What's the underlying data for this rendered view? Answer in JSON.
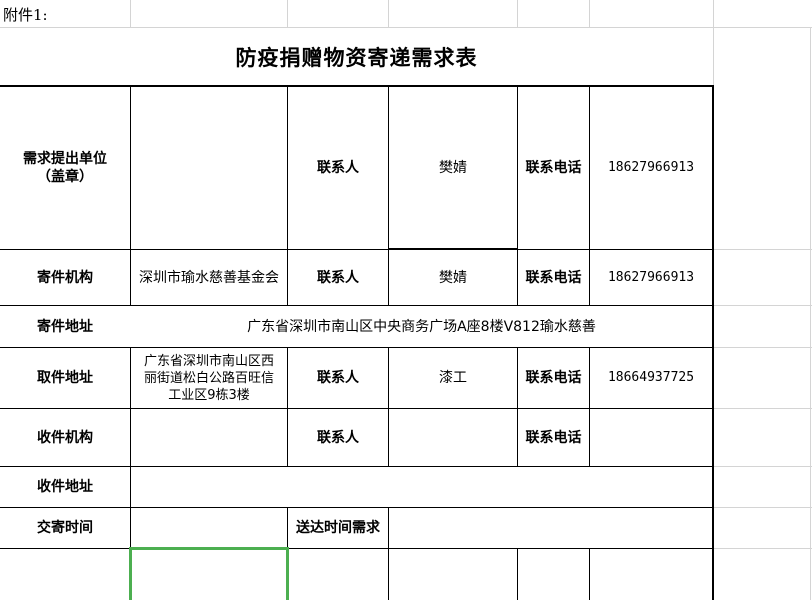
{
  "sheet": {
    "attachment_label": "附件1:",
    "title": "防疫捐赠物资寄递需求表"
  },
  "form": {
    "row1": {
      "label": "需求提出单位\n（盖章）",
      "value": "",
      "contact_label": "联系人",
      "contact_value": "樊婧",
      "phone_label": "联系电话",
      "phone_value": "18627966913"
    },
    "row2": {
      "label": "寄件机构",
      "value": "深圳市瑜水慈善基金会",
      "contact_label": "联系人",
      "contact_value": "樊婧",
      "phone_label": "联系电话",
      "phone_value": "18627966913"
    },
    "row3": {
      "label": "寄件地址",
      "value": "广东省深圳市南山区中央商务广场A座8楼V812瑜水慈善"
    },
    "row4": {
      "label": "取件地址",
      "value": "广东省深圳市南山区西\n丽街道松白公路百旺信\n工业区9栋3楼",
      "contact_label": "联系人",
      "contact_value": "漆工",
      "phone_label": "联系电话",
      "phone_value": "18664937725"
    },
    "row5": {
      "label": "收件机构",
      "value": "",
      "contact_label": "联系人",
      "contact_value": "",
      "phone_label": "联系电话",
      "phone_value": ""
    },
    "row6": {
      "label": "收件地址",
      "value": ""
    },
    "row7": {
      "label": "交寄时间",
      "value": "",
      "delivery_label": "送达时间需求",
      "delivery_value": ""
    }
  },
  "colors": {
    "gridline": "#d4d4d4",
    "border": "#000000",
    "selection": "#4caf50"
  }
}
